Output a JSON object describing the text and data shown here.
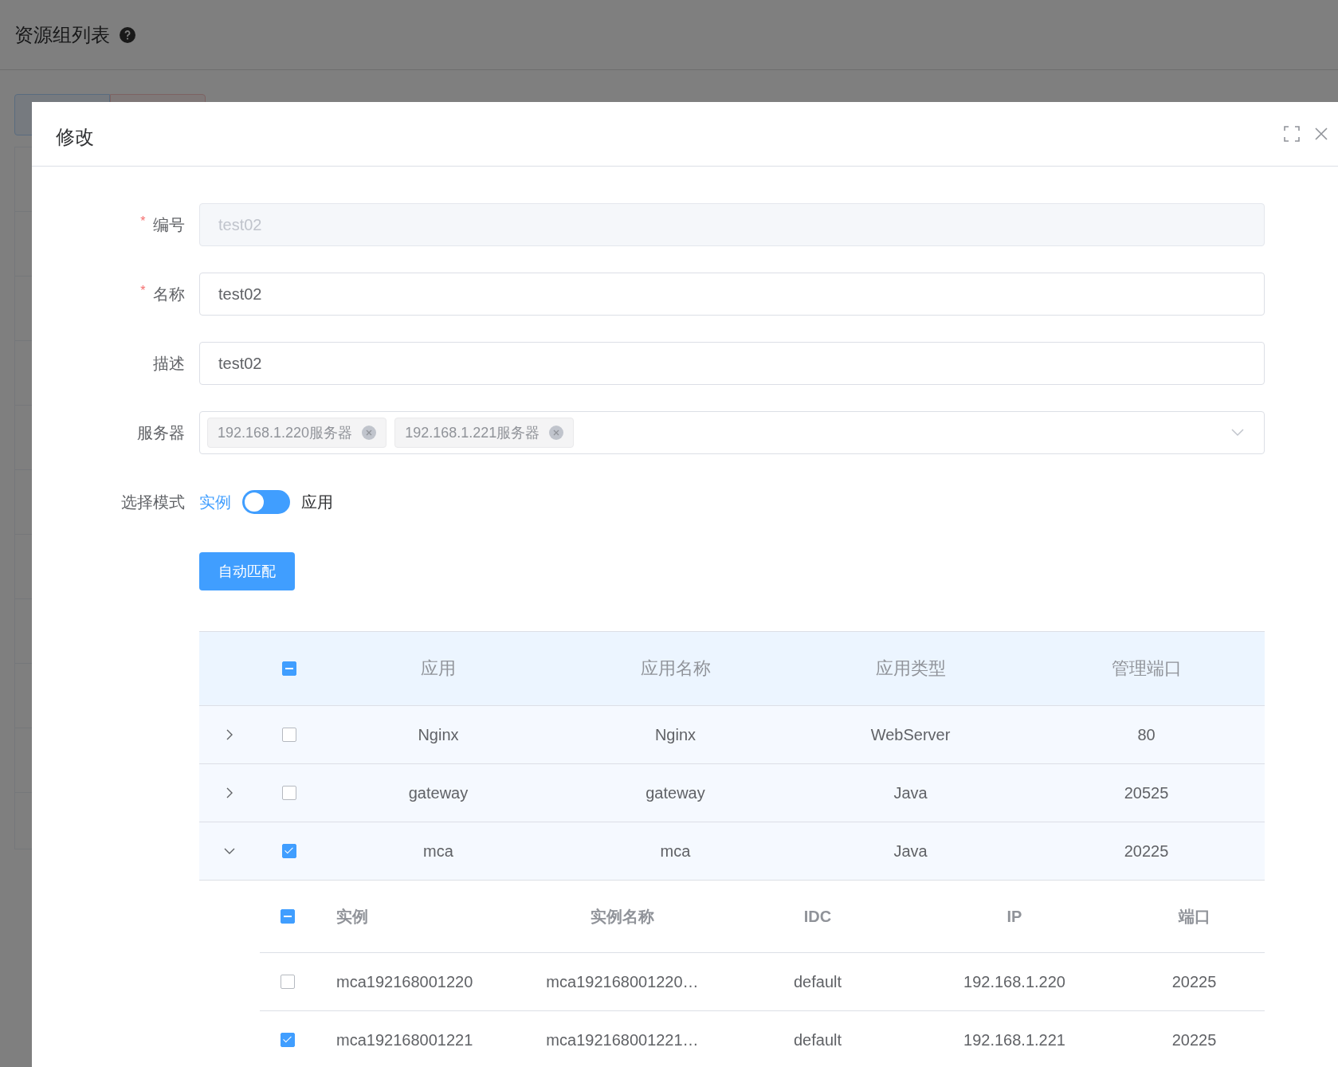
{
  "page": {
    "title": "资源组列表"
  },
  "dialog": {
    "title": "修改",
    "fields": [
      {
        "kind": "input",
        "label": "编号",
        "required_mark": "*",
        "value": "test02",
        "disabled": true
      },
      {
        "kind": "input",
        "label": "名称",
        "required_mark": "*",
        "value": "test02",
        "disabled": false
      },
      {
        "kind": "input",
        "label": "描述",
        "value": "test02",
        "disabled": false
      },
      {
        "kind": "tags",
        "label": "服务器",
        "tags": [
          "192.168.1.220服务器",
          "192.168.1.221服务器"
        ]
      },
      {
        "kind": "switch",
        "label": "选择模式",
        "left_label": "实例",
        "right_label": "应用",
        "on": false
      }
    ],
    "action_button": "自动匹配",
    "table": {
      "indeterminate": true,
      "columns": [
        "应用",
        "应用名称",
        "应用类型",
        "管理端口"
      ],
      "rows": [
        {
          "cells": [
            "Nginx",
            "Nginx",
            "WebServer",
            "80"
          ],
          "checked": false,
          "expanded": false
        },
        {
          "cells": [
            "gateway",
            "gateway",
            "Java",
            "20525"
          ],
          "checked": false,
          "expanded": false
        },
        {
          "cells": [
            "mca",
            "mca",
            "Java",
            "20225"
          ],
          "checked": true,
          "expanded": true,
          "sub_table": {
            "indeterminate": true,
            "columns": [
              "实例",
              "实例名称",
              "IDC",
              "IP",
              "端口"
            ],
            "rows": [
              {
                "cells": [
                  "mca192168001220",
                  "mca192168001220…",
                  "default",
                  "192.168.1.220",
                  "20225"
                ],
                "checked": false
              },
              {
                "cells": [
                  "mca192168001221",
                  "mca192168001221…",
                  "default",
                  "192.168.1.221",
                  "20225"
                ],
                "checked": true
              }
            ]
          }
        }
      ]
    }
  }
}
